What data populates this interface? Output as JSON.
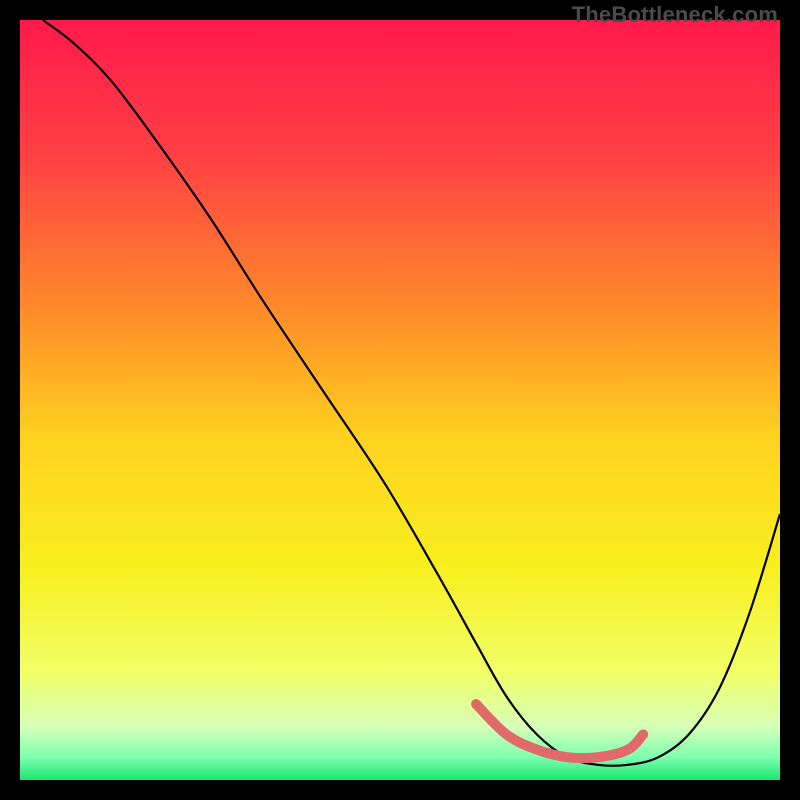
{
  "watermark": "TheBottleneck.com",
  "chart_data": {
    "type": "line",
    "title": "",
    "xlabel": "",
    "ylabel": "",
    "xlim": [
      0,
      100
    ],
    "ylim": [
      0,
      100
    ],
    "gradient_stops": [
      {
        "offset": 0,
        "color": "#ff1a4b"
      },
      {
        "offset": 18,
        "color": "#ff4044"
      },
      {
        "offset": 38,
        "color": "#ff8a2a"
      },
      {
        "offset": 55,
        "color": "#ffd21f"
      },
      {
        "offset": 72,
        "color": "#f8ef1f"
      },
      {
        "offset": 86,
        "color": "#f1ff68"
      },
      {
        "offset": 93,
        "color": "#d6ffb8"
      },
      {
        "offset": 97,
        "color": "#7fffb0"
      },
      {
        "offset": 100,
        "color": "#19e66e"
      }
    ],
    "series": [
      {
        "name": "bottleneck-curve",
        "x": [
          3,
          7,
          12,
          18,
          25,
          32,
          40,
          48,
          55,
          60,
          64,
          68,
          72,
          76,
          80,
          84,
          88,
          92,
          96,
          100
        ],
        "y": [
          100,
          97,
          92,
          84,
          74,
          63,
          51,
          39,
          27,
          18,
          11,
          6,
          3,
          2,
          2,
          3,
          6,
          12,
          22,
          35
        ]
      }
    ],
    "highlight_band": {
      "name": "flat-region-marker",
      "color": "#e06a6a",
      "x": [
        60,
        64,
        68,
        72,
        76,
        80,
        82
      ],
      "y": [
        10,
        6,
        4,
        3,
        3,
        4,
        6
      ]
    }
  }
}
